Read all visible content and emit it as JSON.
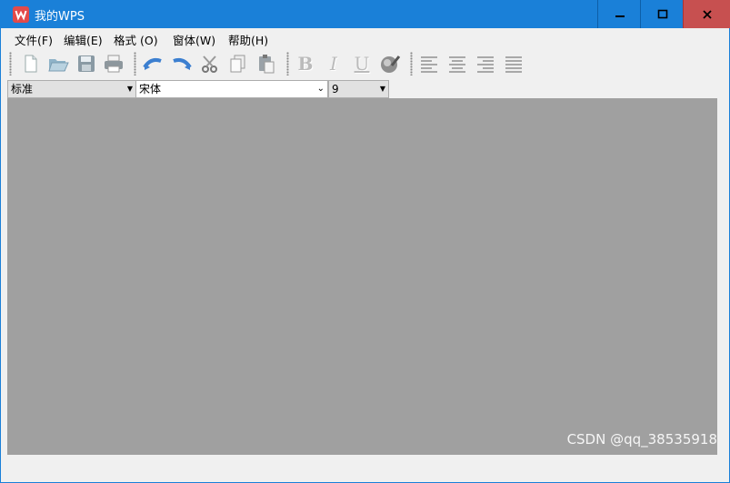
{
  "window": {
    "title": "我的WPS",
    "minimize": "—",
    "maximize": "□",
    "close": "✕"
  },
  "menu": {
    "items": [
      "文件(F)",
      "编辑(E)",
      "格式 (O)",
      "窗体(W)",
      "帮助(H)"
    ]
  },
  "toolbar": {
    "buttons": [
      {
        "name": "new-icon"
      },
      {
        "name": "open-icon"
      },
      {
        "name": "save-icon"
      },
      {
        "name": "print-icon"
      },
      {
        "name": "undo-icon"
      },
      {
        "name": "redo-icon"
      },
      {
        "name": "cut-icon"
      },
      {
        "name": "copy-icon"
      },
      {
        "name": "paste-icon"
      },
      {
        "name": "bold-icon",
        "label": "B"
      },
      {
        "name": "italic-icon",
        "label": "I"
      },
      {
        "name": "underline-icon",
        "label": "U"
      },
      {
        "name": "color-icon"
      },
      {
        "name": "align-left-icon"
      },
      {
        "name": "align-center-icon"
      },
      {
        "name": "align-right-icon"
      },
      {
        "name": "justify-icon"
      }
    ]
  },
  "format": {
    "style": "标准",
    "font": "宋体",
    "size": "9"
  },
  "watermark": "CSDN @qq_38535918",
  "colors": {
    "titlebar": "#1a80d8",
    "close": "#c75050",
    "workspace": "#a0a0a0"
  }
}
